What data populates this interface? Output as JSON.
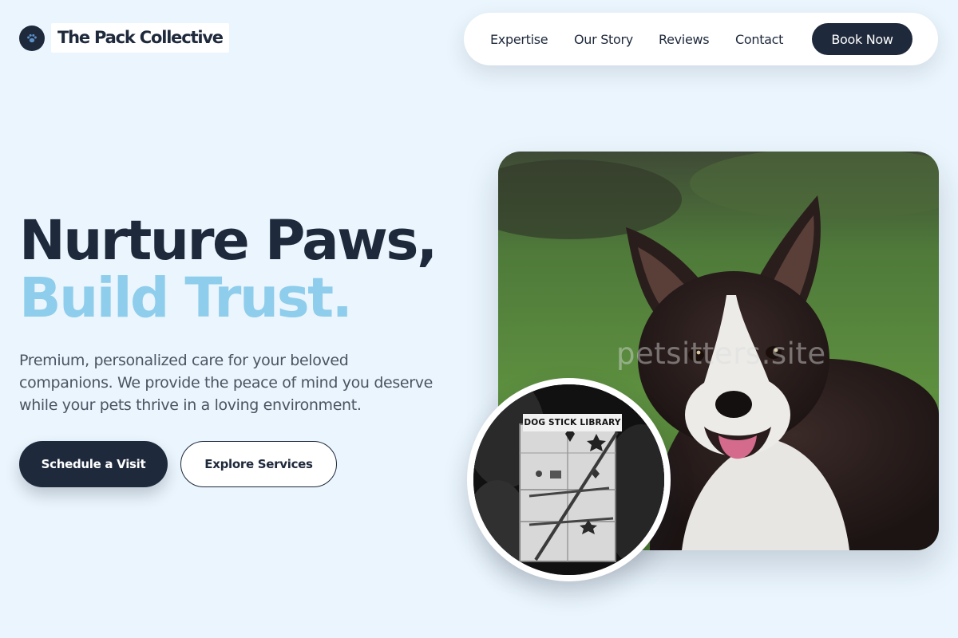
{
  "brand": {
    "name": "The Pack Collective",
    "logo_icon": "paw-icon"
  },
  "nav": {
    "links": [
      "Expertise",
      "Our Story",
      "Reviews",
      "Contact"
    ],
    "cta": "Book Now"
  },
  "hero": {
    "title_line1": "Nurture Paws,",
    "title_line2": "Build Trust.",
    "description": "Premium, personalized care for your beloved companions. We provide the peace of mind you deserve while your pets thrive in a loving environment.",
    "primary_cta": "Schedule a Visit",
    "secondary_cta": "Explore Services"
  },
  "image": {
    "watermark": "petsitters.site",
    "inset_sign": "DOG STICK LIBRARY"
  },
  "colors": {
    "navy": "#1e293b",
    "sky": "#8ecdeb",
    "background": "#eaf5fd"
  }
}
